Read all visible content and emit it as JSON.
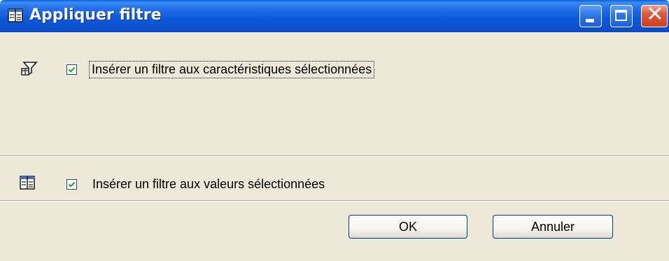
{
  "window": {
    "title": "Appliquer filtre",
    "controls": [
      "minimize",
      "maximize",
      "close"
    ],
    "title_icon": "filter-table-icon"
  },
  "options": [
    {
      "icon": "filter-funnel-icon",
      "checked": true,
      "label": "Insérer un filtre aux caractéristiques sélectionnées"
    },
    {
      "icon": "filter-table-icon",
      "checked": true,
      "label": "Insérer un filtre aux valeurs sélectionnées"
    }
  ],
  "buttons": {
    "ok_label": "OK",
    "cancel_label": "Annuler"
  },
  "colors": {
    "titlebar": "#0c59de",
    "dialog_bg": "#ece9d8",
    "checkmark": "#21a121",
    "close_button": "#e0583a"
  }
}
